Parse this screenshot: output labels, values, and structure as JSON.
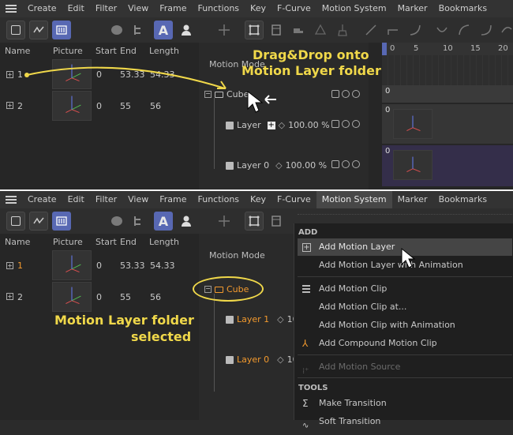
{
  "menu": [
    "Create",
    "Edit",
    "Filter",
    "View",
    "Frame",
    "Functions",
    "Key",
    "F-Curve",
    "Motion System",
    "Marker",
    "Bookmarks"
  ],
  "columns": {
    "name": "Name",
    "picture": "Picture",
    "start": "Start",
    "end": "End",
    "length": "Length"
  },
  "rows": [
    {
      "name": "1",
      "start": "0",
      "end": "53.33",
      "length": "54.33"
    },
    {
      "name": "2",
      "start": "0",
      "end": "55",
      "length": "56"
    }
  ],
  "motion_mode": "Motion Mode",
  "tree": {
    "folder": "Cube",
    "layer1": "Layer 1",
    "layer1_top": "Layer",
    "layer0": "Layer 0",
    "value": "100.00 %",
    "value_short": "100"
  },
  "ruler": [
    "0",
    "5",
    "10",
    "15",
    "20"
  ],
  "tracks": [
    "0",
    "0",
    "0"
  ],
  "callouts": {
    "top_line1": "Drag&Drop onto",
    "top_line2": "Motion Layer folder",
    "bottom_line1": "Motion Layer folder",
    "bottom_line2": "selected"
  },
  "dropdown": {
    "section_add": "ADD",
    "section_tools": "TOOLS",
    "items": [
      "Add Motion Layer",
      "Add Motion Layer with Animation",
      "Add Motion Clip",
      "Add Motion Clip at...",
      "Add Motion Clip with Animation",
      "Add Compound Motion Clip",
      "Add Motion Source",
      "Make Transition",
      "Soft Transition"
    ]
  },
  "colors": {
    "accent": "#5868b3",
    "callout": "#f0d84a",
    "selected_text": "#f39a2e"
  }
}
